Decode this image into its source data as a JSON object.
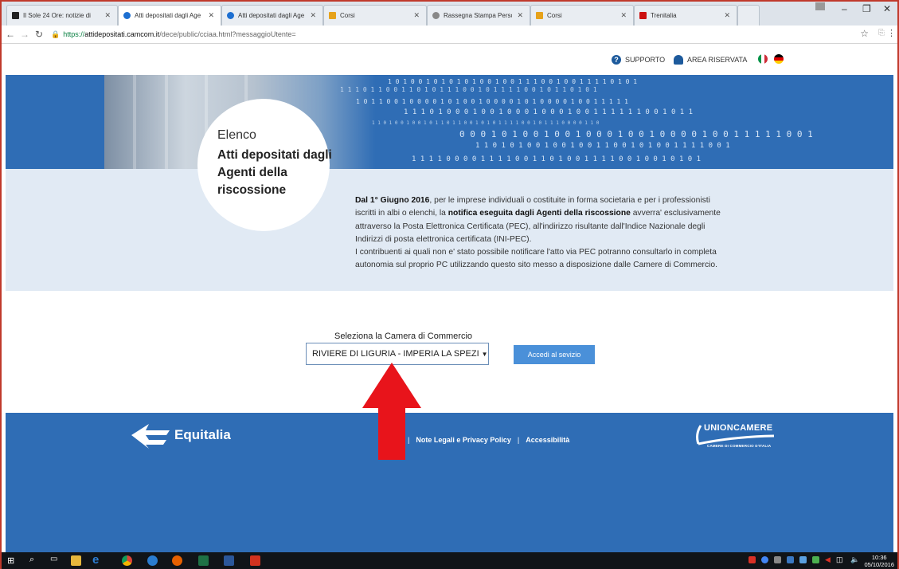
{
  "browser": {
    "tabs": [
      {
        "label": "Il Sole 24 Ore: notizie di",
        "fav_color": "#222"
      },
      {
        "label": "Atti depositati dagli Age",
        "fav_color": "#1d6fd1"
      },
      {
        "label": "Atti depositati dagli Age",
        "fav_color": "#1d6fd1"
      },
      {
        "label": "Corsi",
        "fav_color": "#e6a21b"
      },
      {
        "label": "Rassegna Stampa Person",
        "fav_color": "#888"
      },
      {
        "label": "Corsi",
        "fav_color": "#e6a21b"
      },
      {
        "label": "Trenitalia",
        "fav_color": "#c11"
      }
    ],
    "url_prefix": "https://",
    "url_host": "attidepositati.camcom.it",
    "url_path": "/dece/public/cciaa.html?messaggioUtente="
  },
  "header": {
    "support_label": "SUPPORTO",
    "area_label": "AREA RISERVATA"
  },
  "hero": {
    "line1": "Elenco",
    "title": "Atti depositati dagli Agenti della riscossione"
  },
  "description": {
    "date": "Dal 1° Giugno 2016",
    "part1": ", per le imprese individuali o costituite in forma societaria e per i professionisti iscritti in albi o elenchi, la ",
    "bold2": "notifica eseguita dagli Agenti della riscossione",
    "part2": " avverra' esclusivamente attraverso la Posta Elettronica Certificata (PEC), all'indirizzo risultante dall'Indice Nazionale degli Indirizzi di posta elettronica certificata (INI-PEC).",
    "part3": "I contribuenti ai quali non e' stato possibile notificare l'atto via PEC potranno consultarlo in completa autonomia sul proprio PC utilizzando questo sito messo a disposizione dalle Camere di Commercio."
  },
  "form": {
    "label": "Seleziona la Camera di Commercio",
    "selected": "RIVIERE DI LIGURIA - IMPERIA LA SPEZI",
    "button": "Accedi al sevizio"
  },
  "footer": {
    "brand": "Equitalia",
    "links": [
      "Note Legali e Privacy Policy",
      "Accessibilità"
    ],
    "partner": "UNIONCAMERE",
    "partner_sub": "CAMERE DI COMMERCIO D'ITALIA"
  },
  "taskbar": {
    "time": "10:36",
    "date": "05/10/2016"
  },
  "colors": {
    "hero_blue": "#2f6db5",
    "band": "#e1eaf4",
    "button": "#4a90d9",
    "annotation_arrow": "#e8141b"
  }
}
